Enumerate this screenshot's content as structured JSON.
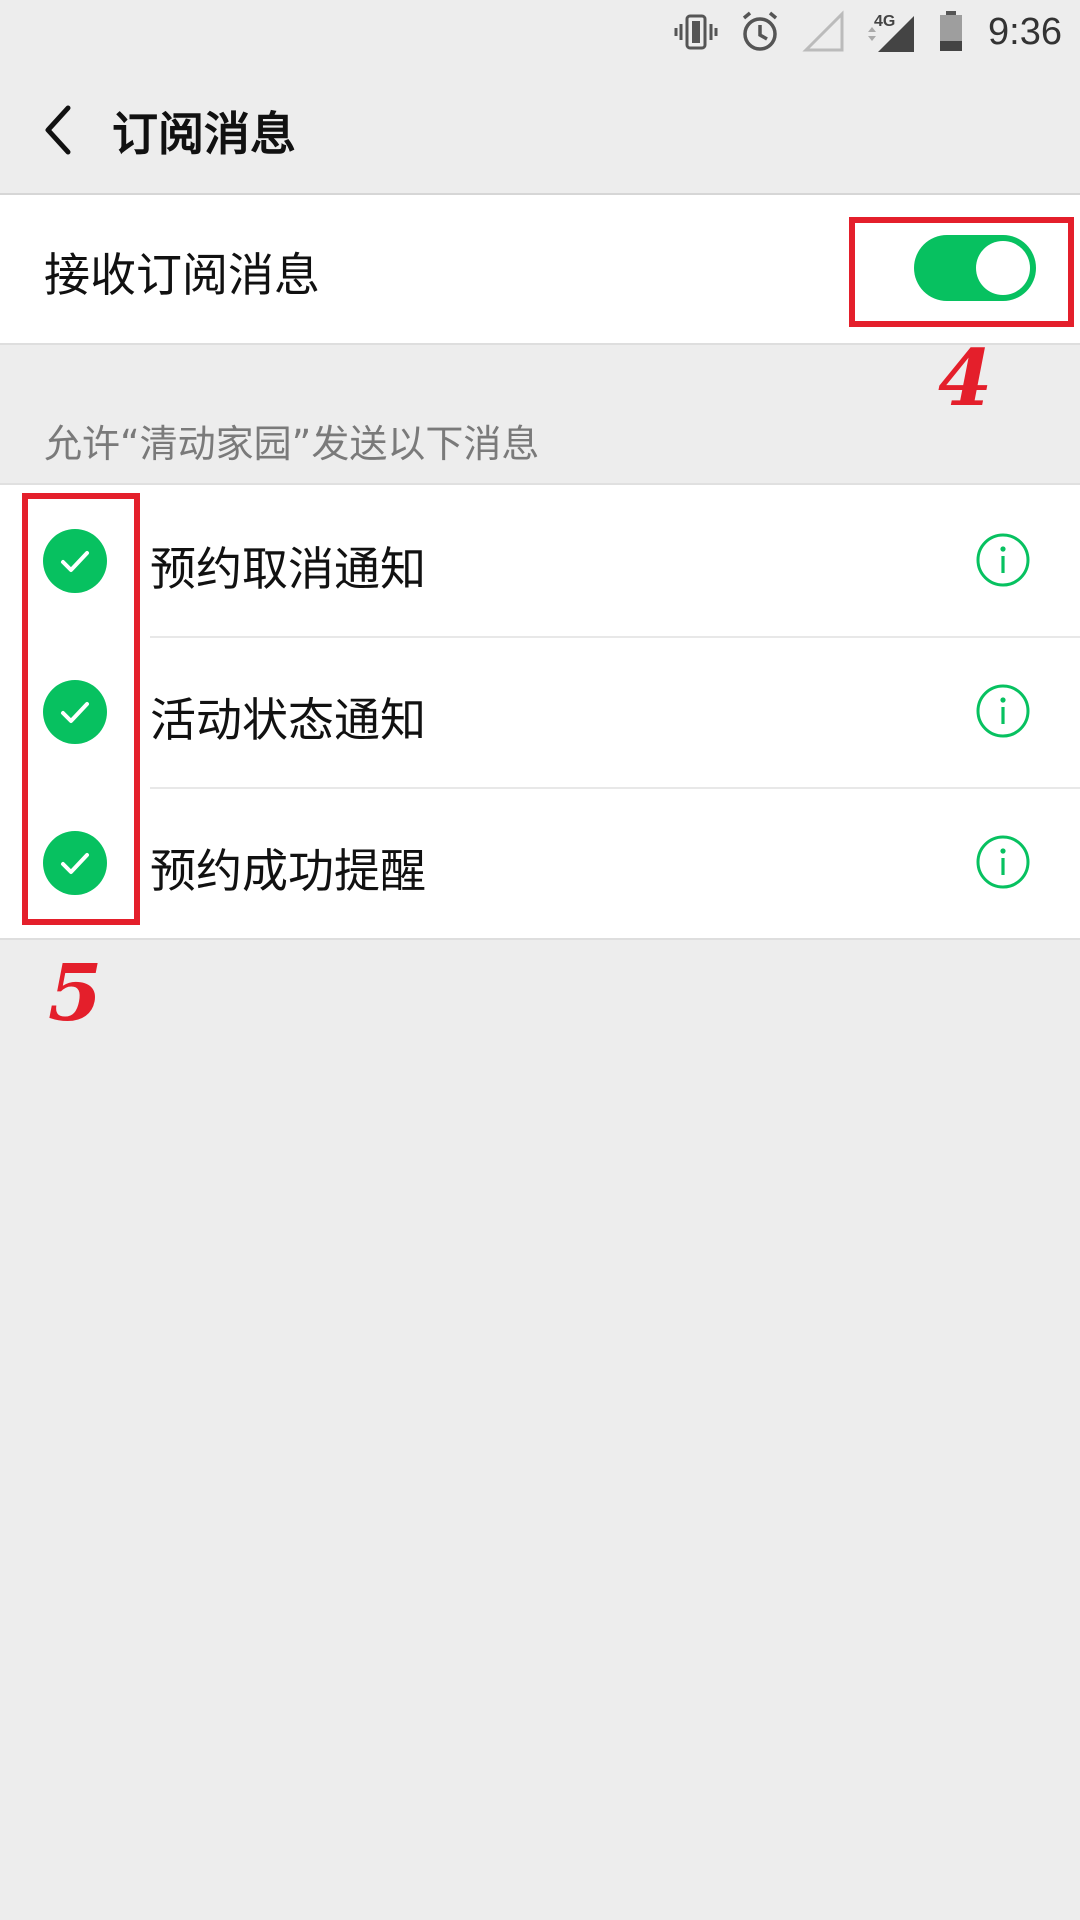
{
  "status_bar": {
    "time": "9:36",
    "network": "4G",
    "icons": [
      "vibrate-icon",
      "alarm-icon",
      "signal-empty-icon",
      "signal-4g-icon",
      "battery-icon"
    ]
  },
  "header": {
    "title": "订阅消息",
    "back_icon": "chevron-left-icon"
  },
  "toggle_row": {
    "label": "接收订阅消息",
    "enabled": true
  },
  "section": {
    "caption": "允许“清动家园”发送以下消息"
  },
  "items": [
    {
      "label": "预约取消通知",
      "checked": true
    },
    {
      "label": "活动状态通知",
      "checked": true
    },
    {
      "label": "预约成功提醒",
      "checked": true
    }
  ],
  "annotations": {
    "toggle_number": "4",
    "checks_number": "5"
  },
  "colors": {
    "accent": "#07c160",
    "annotation": "#e41f2b",
    "background": "#ededed"
  }
}
